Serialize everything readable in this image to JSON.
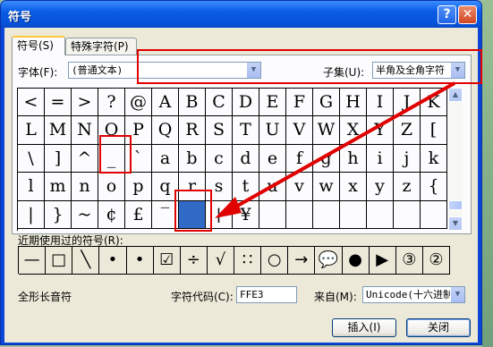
{
  "window": {
    "title": "符号",
    "help_icon": "?",
    "close_icon": "✕"
  },
  "tabs": [
    {
      "label": "符号(S)"
    },
    {
      "label": "特殊字符(P)"
    }
  ],
  "font": {
    "label": "字体(F):",
    "value": "(普通文本)"
  },
  "subset": {
    "label": "子集(U):",
    "value": "半角及全角字符"
  },
  "symbol_grid": [
    "<",
    "=",
    ">",
    "?",
    "@",
    "A",
    "B",
    "C",
    "D",
    "E",
    "F",
    "G",
    "H",
    "I",
    "J",
    "K",
    "L",
    "M",
    "N",
    "O",
    "P",
    "Q",
    "R",
    "S",
    "T",
    "U",
    "V",
    "W",
    "X",
    "Y",
    "Z",
    "[",
    "\\",
    "]",
    "^",
    "_",
    "`",
    "a",
    "b",
    "c",
    "d",
    "e",
    "f",
    "g",
    "h",
    "i",
    "j",
    "k",
    "l",
    "m",
    "n",
    "o",
    "p",
    "q",
    "r",
    "s",
    "t",
    "u",
    "v",
    "w",
    "x",
    "y",
    "z",
    "{",
    "|",
    "}",
    "~",
    "¢",
    "£",
    "‾",
    "",
    "¦",
    "¥",
    "",
    "",
    "",
    "",
    "",
    "",
    ""
  ],
  "selected_index": 70,
  "recent": {
    "label": "近期使用过的符号(R):",
    "symbols": [
      "—",
      "□",
      "╲",
      "•",
      "•",
      "☑",
      "÷",
      "√",
      "∷",
      "○",
      "→",
      "💬",
      "●",
      "▶",
      "③",
      "②"
    ]
  },
  "char_name": "全形长音符",
  "char_code": {
    "label": "字符代码(C):",
    "value": "FFE3"
  },
  "from": {
    "label": "来自(M):",
    "value": "Unicode(十六进制)"
  },
  "buttons": {
    "insert": "插入(I)",
    "close": "关闭"
  },
  "annotation_color": "#e00000"
}
